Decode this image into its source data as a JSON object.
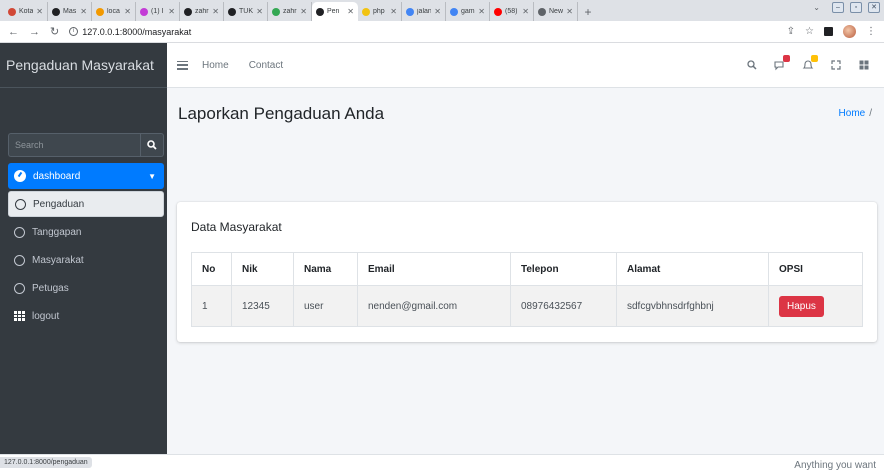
{
  "browser": {
    "tabs": [
      {
        "label": "Kota",
        "color": "#d14836"
      },
      {
        "label": "Mas",
        "color": "#202124"
      },
      {
        "label": "loca",
        "color": "#f29900"
      },
      {
        "label": "(1) I",
        "color": "#c33cd6"
      },
      {
        "label": "zahr",
        "color": "#202124"
      },
      {
        "label": "TUK",
        "color": "#202124"
      },
      {
        "label": "zahr",
        "color": "#34a853"
      },
      {
        "label": "Pen",
        "color": "#202124",
        "active": true
      },
      {
        "label": "php",
        "color": "#f2c311"
      },
      {
        "label": "jalan",
        "color": "#4285f4"
      },
      {
        "label": "gam",
        "color": "#4285f4"
      },
      {
        "label": "(58)",
        "color": "#ff0000"
      },
      {
        "label": "New",
        "color": "#5f6368"
      }
    ],
    "url": "127.0.0.1:8000/masyarakat",
    "status_url": "127.0.0.1:8000/pengaduan"
  },
  "sidebar": {
    "brand": "Pengaduan Masyarakat",
    "search_placeholder": "Search",
    "items": [
      {
        "label": "dashboard"
      },
      {
        "label": "Pengaduan"
      },
      {
        "label": "Tanggapan"
      },
      {
        "label": "Masyarakat"
      },
      {
        "label": "Petugas"
      },
      {
        "label": "logout"
      }
    ]
  },
  "topnav": {
    "home": "Home",
    "contact": "Contact"
  },
  "page": {
    "title": "Laporkan Pengaduan Anda",
    "breadcrumb": "Home",
    "breadcrumb_sep": "/"
  },
  "card": {
    "title": "Data Masyarakat",
    "headers": [
      "No",
      "Nik",
      "Nama",
      "Email",
      "Telepon",
      "Alamat",
      "OPSI"
    ],
    "rows": [
      {
        "no": "1",
        "nik": "12345",
        "nama": "user",
        "email": "nenden@gmail.com",
        "telepon": "08976432567",
        "alamat": "sdfcgvbhnsdrfghbnj",
        "action": "Hapus"
      }
    ]
  },
  "footer": {
    "right_text": "Anything you want"
  },
  "colors": {
    "primary": "#007bff",
    "danger": "#dc3545",
    "sidebar_bg": "#343a40"
  }
}
